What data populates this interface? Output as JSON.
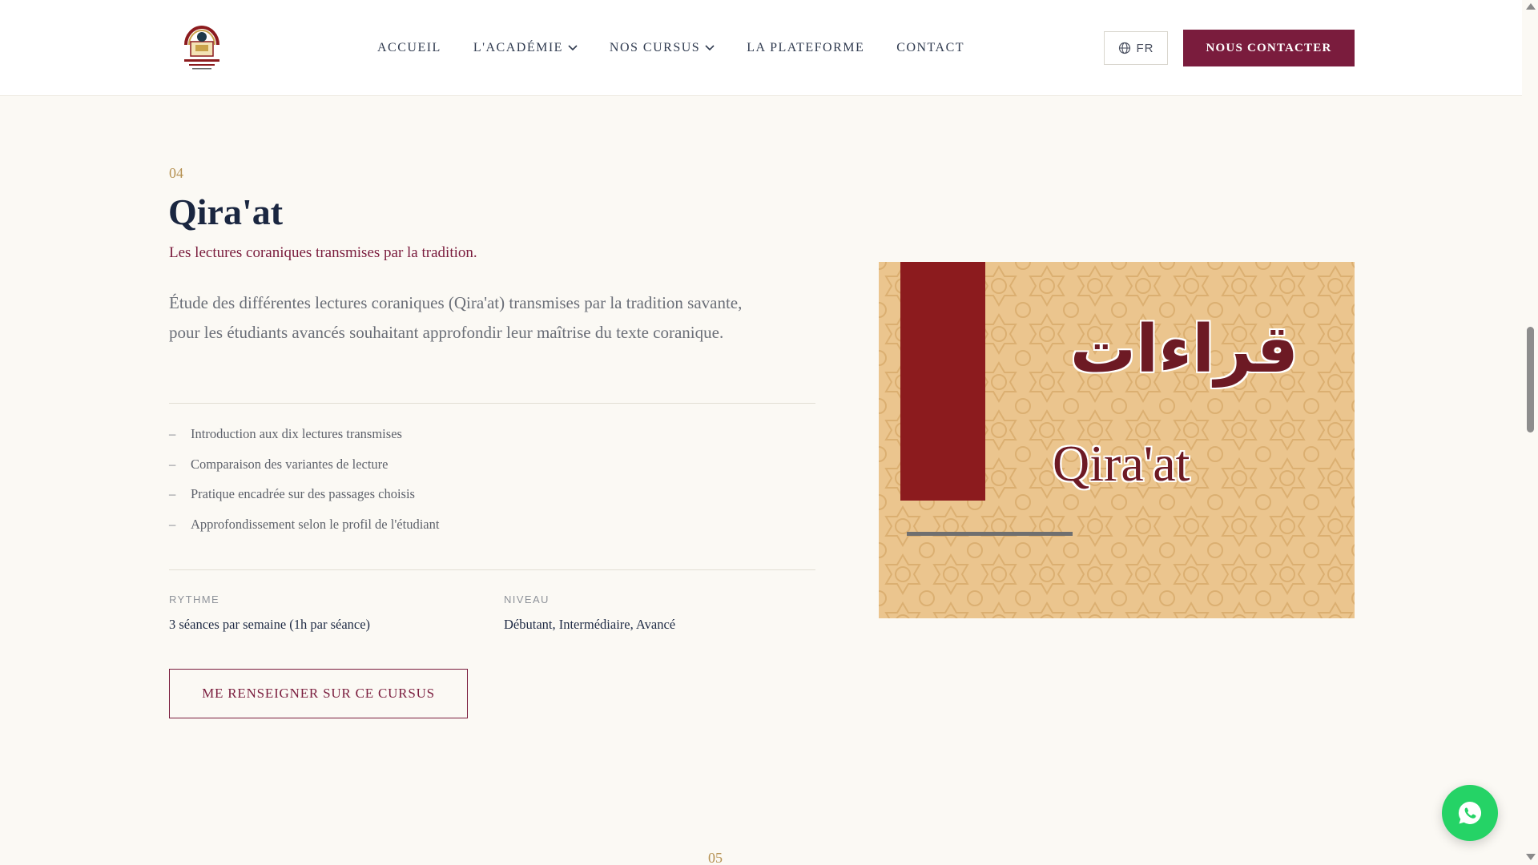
{
  "nav": {
    "items": [
      {
        "label": "ACCUEIL",
        "dropdown": false
      },
      {
        "label": "L'ACADÉMIE",
        "dropdown": true
      },
      {
        "label": "NOS CURSUS",
        "dropdown": true
      },
      {
        "label": "LA PLATEFORME",
        "dropdown": false
      },
      {
        "label": "CONTACT",
        "dropdown": false
      }
    ],
    "lang": "FR",
    "contact_button": "NOUS CONTACTER"
  },
  "course": {
    "number": "04",
    "title": "Qira'at",
    "subtitle": "Les lectures coraniques transmises par la tradition.",
    "description": "Étude des différentes lectures coraniques (Qira'at) transmises par la tradition savante, pour les étudiants avancés souhaitant approfondir leur maîtrise du texte coranique.",
    "features": [
      "Introduction aux dix lectures transmises",
      "Comparaison des variantes de lecture",
      "Pratique encadrée sur des passages choisis",
      "Approfondissement selon le profil de l'étudiant"
    ],
    "rhythm_label": "RYTHME",
    "rhythm_value": "3 séances par semaine (1h par séance)",
    "level_label": "NIVEAU",
    "level_value": "Débutant, Intermédiaire, Avancé",
    "cta": "ME RENSEIGNER SUR CE CURSUS"
  },
  "card": {
    "arabic": "قراءات",
    "latin": "Qira'at"
  },
  "next_number": "05",
  "colors": {
    "brand": "#7a1c3d",
    "accent_gold": "#b69253",
    "card_bg": "#ebc58e",
    "card_bar": "#8c1b1e",
    "whatsapp": "#25d366"
  }
}
